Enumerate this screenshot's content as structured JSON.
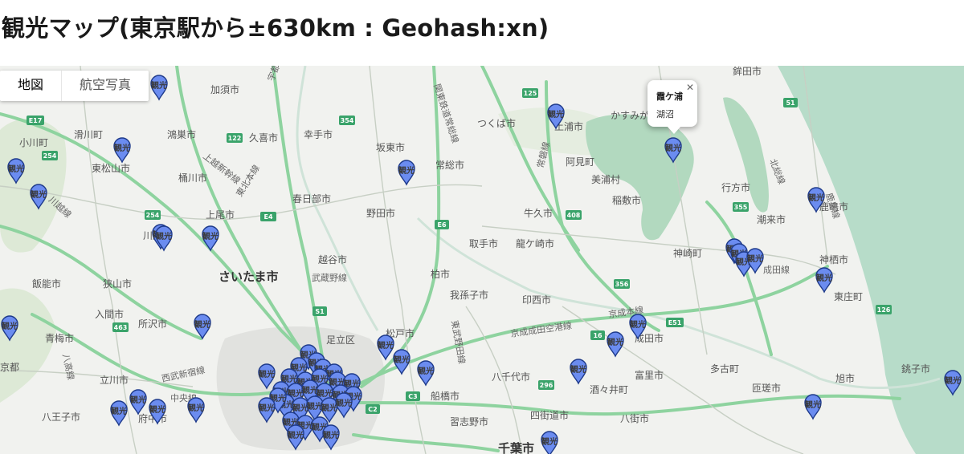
{
  "page": {
    "title": "観光マップ(東京駅から±630km : Geohash:xn)"
  },
  "map": {
    "controls": {
      "map_label": "地図",
      "satellite_label": "航空写真"
    },
    "info_window": {
      "title": "霞ケ浦",
      "body": "湖沼",
      "close_icon": "close-icon"
    },
    "marker_label": "観光",
    "colors": {
      "background": "#f1f2ef",
      "sea": "#b7dcc9",
      "forest": "#dde9d6",
      "lake": "#b2d9bf",
      "highway": "#8ed39f",
      "marker": "#6b8cf0",
      "marker_stroke": "#1e3a8a",
      "urban": "#e3e4e2"
    },
    "places": [
      {
        "name": "鉾田市"
      },
      {
        "name": "加須市"
      },
      {
        "name": "かすみが"
      },
      {
        "name": "つくば市"
      },
      {
        "name": "土浦市"
      },
      {
        "name": "鴻巣市"
      },
      {
        "name": "久喜市"
      },
      {
        "name": "幸手市"
      },
      {
        "name": "滑川町"
      },
      {
        "name": "小川町"
      },
      {
        "name": "東松山市"
      },
      {
        "name": "坂東市"
      },
      {
        "name": "常総市"
      },
      {
        "name": "阿見町"
      },
      {
        "name": "桶川市"
      },
      {
        "name": "美浦村"
      },
      {
        "name": "行方市"
      },
      {
        "name": "春日部市"
      },
      {
        "name": "稲敷市"
      },
      {
        "name": "上尾市"
      },
      {
        "name": "野田市"
      },
      {
        "name": "牛久市"
      },
      {
        "name": "潮来市"
      },
      {
        "name": "鹿嶋市"
      },
      {
        "name": "川越市"
      },
      {
        "name": "取手市"
      },
      {
        "name": "龍ケ崎市"
      },
      {
        "name": "神崎町"
      },
      {
        "name": "越谷市"
      },
      {
        "name": "神栖市"
      },
      {
        "name": "さいたま市"
      },
      {
        "name": "柏市"
      },
      {
        "name": "飯能市"
      },
      {
        "name": "狭山市"
      },
      {
        "name": "我孫子市"
      },
      {
        "name": "印西市"
      },
      {
        "name": "東庄町"
      },
      {
        "name": "入間市"
      },
      {
        "name": "所沢市"
      },
      {
        "name": "足立区"
      },
      {
        "name": "松戸市"
      },
      {
        "name": "成田市"
      },
      {
        "name": "青梅市"
      },
      {
        "name": "多古町"
      },
      {
        "name": "京都"
      },
      {
        "name": "八千代市"
      },
      {
        "name": "富里市"
      },
      {
        "name": "旭市"
      },
      {
        "name": "銚子市"
      },
      {
        "name": "立川市"
      },
      {
        "name": "酒々井町"
      },
      {
        "name": "匝瑳市"
      },
      {
        "name": "船橋市"
      },
      {
        "name": "八王子市"
      },
      {
        "name": "府中市"
      },
      {
        "name": "四街道市"
      },
      {
        "name": "八街市"
      },
      {
        "name": "習志野市"
      },
      {
        "name": "千葉市"
      }
    ],
    "rail_labels": [
      {
        "name": "宇都宮線"
      },
      {
        "name": "関東鉄道常総線"
      },
      {
        "name": "上越新幹線"
      },
      {
        "name": "東北本線"
      },
      {
        "name": "武蔵野線"
      },
      {
        "name": "常磐線"
      },
      {
        "name": "成田線"
      },
      {
        "name": "京成成田空港線"
      },
      {
        "name": "京成本線"
      },
      {
        "name": "北総線"
      },
      {
        "name": "西武新宿線"
      },
      {
        "name": "中央線"
      },
      {
        "name": "東武野田線"
      },
      {
        "name": "八高線"
      },
      {
        "name": "川越線"
      },
      {
        "name": "鹿島線"
      }
    ],
    "route_shields": [
      "E17",
      "254",
      "125",
      "354",
      "122",
      "E4",
      "51",
      "355",
      "408",
      "254",
      "E6",
      "356",
      "E51",
      "16",
      "296",
      "C3",
      "C2",
      "463",
      "S1",
      "126"
    ]
  }
}
